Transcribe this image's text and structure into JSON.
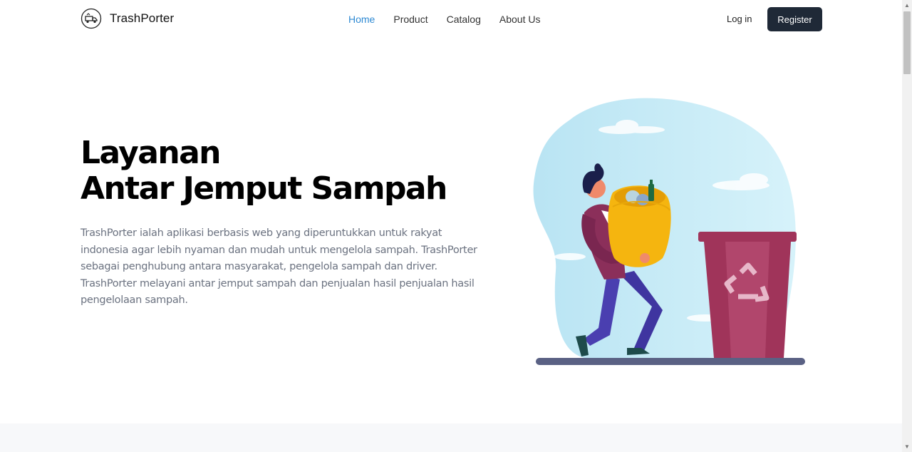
{
  "brand": {
    "name": "TrashPorter",
    "logo_icon": "trash-truck-icon"
  },
  "nav": {
    "items": [
      {
        "label": "Home",
        "active": true
      },
      {
        "label": "Product",
        "active": false
      },
      {
        "label": "Catalog",
        "active": false
      },
      {
        "label": "About Us",
        "active": false
      }
    ],
    "login_label": "Log in",
    "register_label": "Register"
  },
  "hero": {
    "title_line1": "Layanan",
    "title_line2": "Antar Jemput Sampah",
    "description": "TrashPorter ialah aplikasi berbasis web yang diperuntukkan untuk rakyat indonesia agar lebih nyaman dan mudah untuk mengelola sampah. TrashPorter sebagai penghubung antara masyarakat, pengelola sampah dan driver. TrashPorter melayani antar jemput sampah dan penjualan hasil penjualan hasil pengelolaan sampah."
  },
  "colors": {
    "accent": "#2f8ad3",
    "dark_button": "#1f2937",
    "bin": "#a0345a",
    "bag": "#f5b50f",
    "blob": "#c9ecf6"
  }
}
